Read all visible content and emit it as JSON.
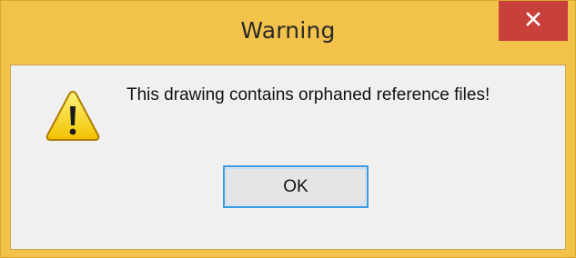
{
  "window": {
    "title": "Warning"
  },
  "titlebar": {
    "close_icon": "close-icon",
    "close_color": "#c7403a",
    "frame_color": "#f3c24a"
  },
  "dialog": {
    "icon": "warning-icon",
    "message": "This drawing contains orphaned reference files!",
    "ok_label": "OK",
    "focus_color": "#3c9be0"
  }
}
